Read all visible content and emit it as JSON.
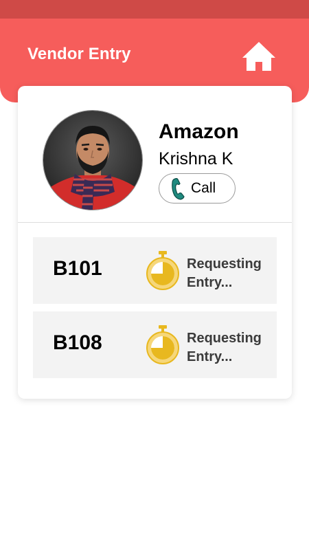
{
  "header": {
    "title": "Vendor Entry",
    "background_color": "#f65d5b",
    "status_bar_color": "#cf4a47",
    "home_icon": "home-icon"
  },
  "vendor": {
    "company": "Amazon",
    "person": "Krishna K",
    "call_label": "Call",
    "call_icon": "phone-icon"
  },
  "entries": [
    {
      "unit": "B101",
      "status": "Requesting Entry...",
      "icon": "stopwatch-icon"
    },
    {
      "unit": "B108",
      "status": "Requesting Entry...",
      "icon": "stopwatch-icon"
    }
  ],
  "colors": {
    "timer_fill": "#e8b81f",
    "timer_body": "#f6d77a",
    "row_background": "#f3f3f3",
    "phone_icon": "#1f8a7f"
  }
}
